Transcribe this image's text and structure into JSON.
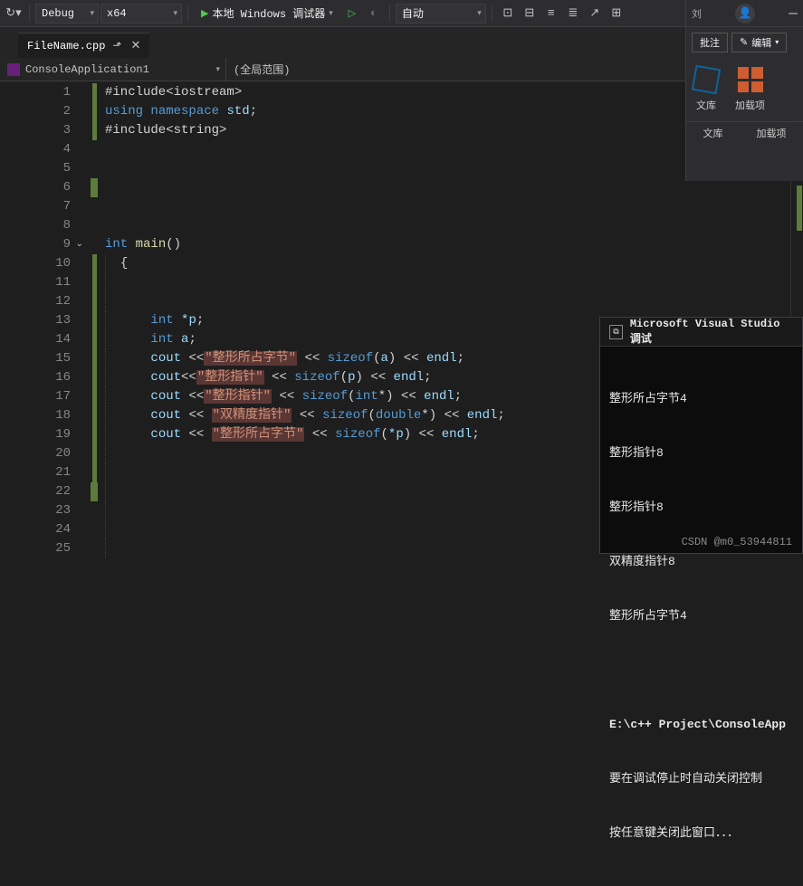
{
  "toolbar": {
    "config": "Debug",
    "platform": "x64",
    "debugger_label": "本地 Windows 调试器",
    "auto_label": "自动"
  },
  "tab": {
    "filename": "FileName.cpp"
  },
  "nav": {
    "project": "ConsoleApplication1",
    "scope": "(全局范围)"
  },
  "code": {
    "l1": "#include<iostream>",
    "l2_using": "using",
    "l2_ns": "namespace",
    "l2_std": "std",
    "l3": "#include<string>",
    "l9_int": "int",
    "l9_main": "main",
    "l13_int": "int",
    "l13_p": "*p",
    "l14_int": "int",
    "l14_a": "a",
    "l15_cout": "cout",
    "l15_str": "\"整形所占字节\"",
    "l15_sizeof": "sizeof",
    "l15_a": "a",
    "l15_endl": "endl",
    "l16_cout": "cout",
    "l16_str": "\"整形指针\"",
    "l16_sizeof": "sizeof",
    "l16_p": "p",
    "l16_endl": "endl",
    "l17_cout": "cout",
    "l17_str": "\"整形指针\"",
    "l17_sizeof": "sizeof",
    "l17_int": "int",
    "l17_endl": "endl",
    "l18_cout": "cout",
    "l18_str": "\"双精度指针\"",
    "l18_sizeof": "sizeof",
    "l18_dbl": "double",
    "l18_endl": "endl",
    "l19_cout": "cout",
    "l19_str": "\"整形所占字节\"",
    "l19_sizeof": "sizeof",
    "l19_p": "*p",
    "l19_endl": "endl"
  },
  "right_panel": {
    "user_initial": "刘",
    "annotate": "批注",
    "edit": "编辑",
    "lib": "文库",
    "loader": "加载项",
    "lib2": "文库",
    "loader2": "加载项"
  },
  "console": {
    "title": "Microsoft Visual Studio 调试",
    "out1": "整形所占字节4",
    "out2": "整形指针8",
    "out3": "整形指针8",
    "out4": "双精度指针8",
    "out5": "整形所占字节4",
    "path": "E:\\c++ Project\\ConsoleApp",
    "msg1": "要在调试停止时自动关闭控制",
    "msg2": "按任意键关闭此窗口．．．"
  },
  "watermark": "CSDN @m0_53944811"
}
